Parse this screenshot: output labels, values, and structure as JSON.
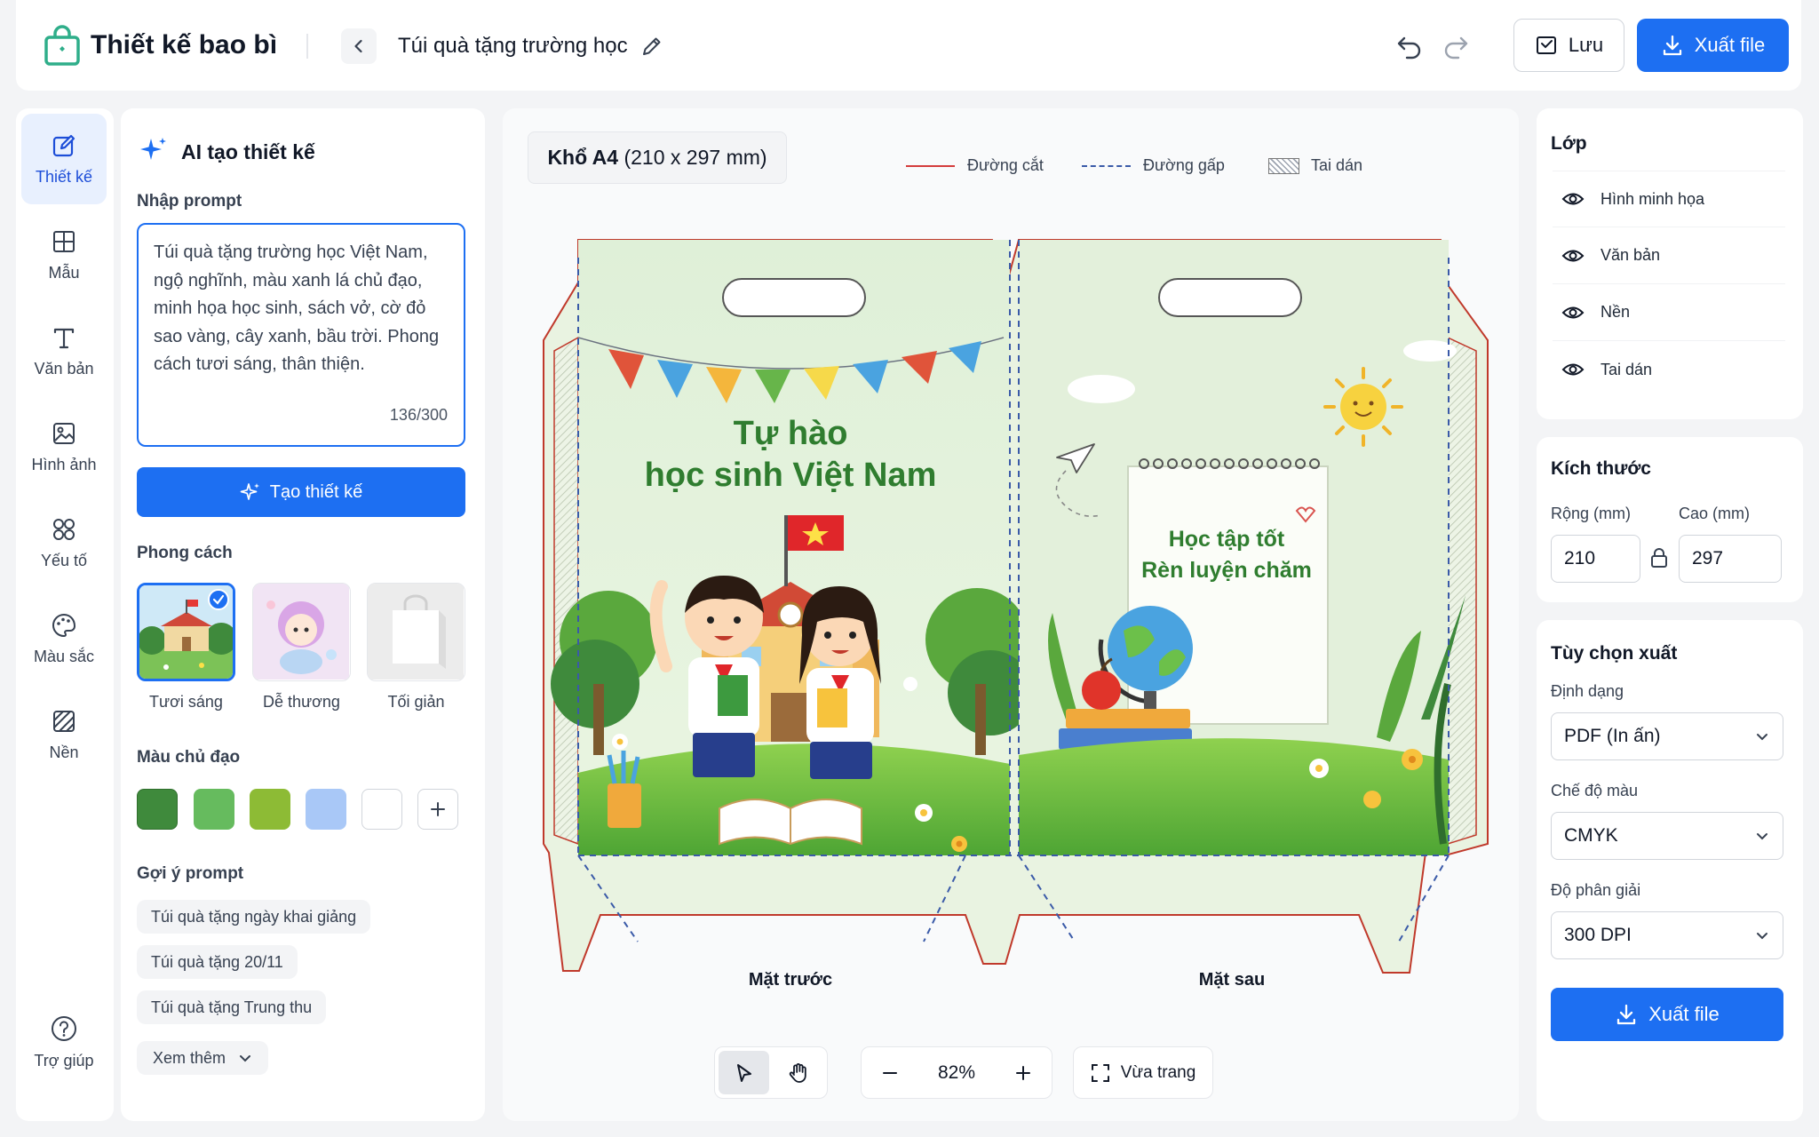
{
  "header": {
    "app_title": "Thiết kế bao bì",
    "document_name": "Túi quà tặng trường học",
    "save_label": "Lưu",
    "export_label": "Xuất file",
    "colors": {
      "accent": "#1d6ff2",
      "brand": "#2fae8a"
    }
  },
  "nav": {
    "items": [
      {
        "label": "Thiết kế",
        "icon": "edit-design-icon",
        "active": true
      },
      {
        "label": "Mẫu",
        "icon": "template-grid-icon"
      },
      {
        "label": "Văn bản",
        "icon": "text-icon"
      },
      {
        "label": "Hình ảnh",
        "icon": "image-icon"
      },
      {
        "label": "Yếu tố",
        "icon": "elements-icon"
      },
      {
        "label": "Màu sắc",
        "icon": "palette-icon"
      },
      {
        "label": "Nền",
        "icon": "background-icon"
      }
    ],
    "help_label": "Trợ giúp"
  },
  "ai_panel": {
    "title": "AI tạo thiết kế",
    "prompt_label": "Nhập prompt",
    "prompt_text": "Túi quà tặng trường học Việt Nam, ngộ nghĩnh, màu xanh lá chủ đạo, minh họa học sinh, sách vở, cờ đỏ sao vàng, cây xanh, bầu trời. Phong cách tươi sáng, thân thiện.",
    "char_count": "136/300",
    "generate_label": "Tạo thiết kế",
    "style_label": "Phong cách",
    "styles": [
      {
        "label": "Tươi sáng",
        "selected": true
      },
      {
        "label": "Dễ thương",
        "selected": false
      },
      {
        "label": "Tối giản",
        "selected": false
      }
    ],
    "color_label": "Màu chủ đạo",
    "swatches": [
      "#3f8a3c",
      "#66bb5e",
      "#8dbb35",
      "#a9c8f7",
      "#ffffff"
    ],
    "suggest_label": "Gợi ý prompt",
    "suggestions": [
      "Túi quà tặng ngày khai giảng",
      "Túi quà tặng 20/11",
      "Túi quà tặng Trung thu"
    ],
    "more_label": "Xem thêm"
  },
  "canvas": {
    "paper_size_bold": "Khổ A4",
    "paper_size_dims": "(210 x 297 mm)",
    "legend": {
      "cut": "Đường cắt",
      "fold": "Đường gấp",
      "glue": "Tai dán"
    },
    "front": {
      "label": "Mặt trước",
      "title_line1": "Tự hào",
      "title_line2": "học sinh Việt Nam"
    },
    "back": {
      "label": "Mặt sau",
      "note_line1": "Học tập tốt",
      "note_line2": "Rèn luyện chăm"
    },
    "zoom": "82%",
    "fit_label": "Vừa trang"
  },
  "right_panel": {
    "layers_title": "Lớp",
    "layers": [
      "Hình minh họa",
      "Văn bản",
      "Nền",
      "Tai dán"
    ],
    "size_title": "Kích thước",
    "width_label": "Rộng (mm)",
    "height_label": "Cao (mm)",
    "width_value": "210",
    "height_value": "297",
    "export_title": "Tùy chọn xuất",
    "format_label": "Định dạng",
    "format_value": "PDF (In ấn)",
    "color_mode_label": "Chế độ màu",
    "color_mode_value": "CMYK",
    "resolution_label": "Độ phân giải",
    "resolution_value": "300 DPI",
    "export_label": "Xuất file"
  }
}
